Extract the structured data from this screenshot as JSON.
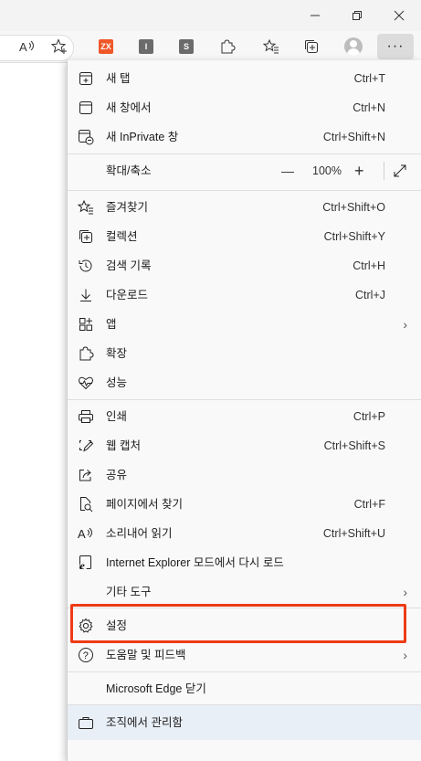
{
  "window": {
    "minimize_icon": "minimize-icon",
    "maximize_icon": "restore-icon",
    "close_icon": "close-icon"
  },
  "toolbar": {
    "read_aloud_icon": "read-aloud-icon",
    "favorite_icon": "add-favorite-icon",
    "extensions": [
      {
        "label": "ZX",
        "color": "#f0582a"
      },
      {
        "label": "I",
        "color": "#6b6b6b"
      },
      {
        "label": "S",
        "color": "#6b6b6b"
      }
    ],
    "more_label": "···"
  },
  "menu": {
    "new_tab": {
      "label": "새 탭",
      "shortcut": "Ctrl+T"
    },
    "new_window": {
      "label": "새 창에서",
      "shortcut": "Ctrl+N"
    },
    "new_inprivate": {
      "label": "새 InPrivate 창",
      "shortcut": "Ctrl+Shift+N"
    },
    "zoom": {
      "label": "확대/축소",
      "minus": "—",
      "value": "100%",
      "plus": "+"
    },
    "favorites": {
      "label": "즐겨찾기",
      "shortcut": "Ctrl+Shift+O"
    },
    "collections": {
      "label": "컬렉션",
      "shortcut": "Ctrl+Shift+Y"
    },
    "history": {
      "label": "검색 기록",
      "shortcut": "Ctrl+H"
    },
    "downloads": {
      "label": "다운로드",
      "shortcut": "Ctrl+J"
    },
    "apps": {
      "label": "앱"
    },
    "extensions": {
      "label": "확장"
    },
    "performance": {
      "label": "성능"
    },
    "print": {
      "label": "인쇄",
      "shortcut": "Ctrl+P"
    },
    "web_capture": {
      "label": "웹 캡처",
      "shortcut": "Ctrl+Shift+S"
    },
    "share": {
      "label": "공유"
    },
    "find": {
      "label": "페이지에서 찾기",
      "shortcut": "Ctrl+F"
    },
    "read_aloud": {
      "label": "소리내어 읽기",
      "shortcut": "Ctrl+Shift+U"
    },
    "ie_mode": {
      "label": "Internet Explorer 모드에서 다시 로드"
    },
    "more_tools": {
      "label": "기타 도구"
    },
    "settings": {
      "label": "설정"
    },
    "help": {
      "label": "도움말 및 피드백"
    },
    "close_edge": {
      "label": "Microsoft Edge 닫기"
    },
    "managed": {
      "label": "조직에서 관리함"
    }
  },
  "colors": {
    "highlight": "#ee3b17",
    "menu_bg": "#f9f9f9",
    "managed_bg": "#e9eff7"
  }
}
